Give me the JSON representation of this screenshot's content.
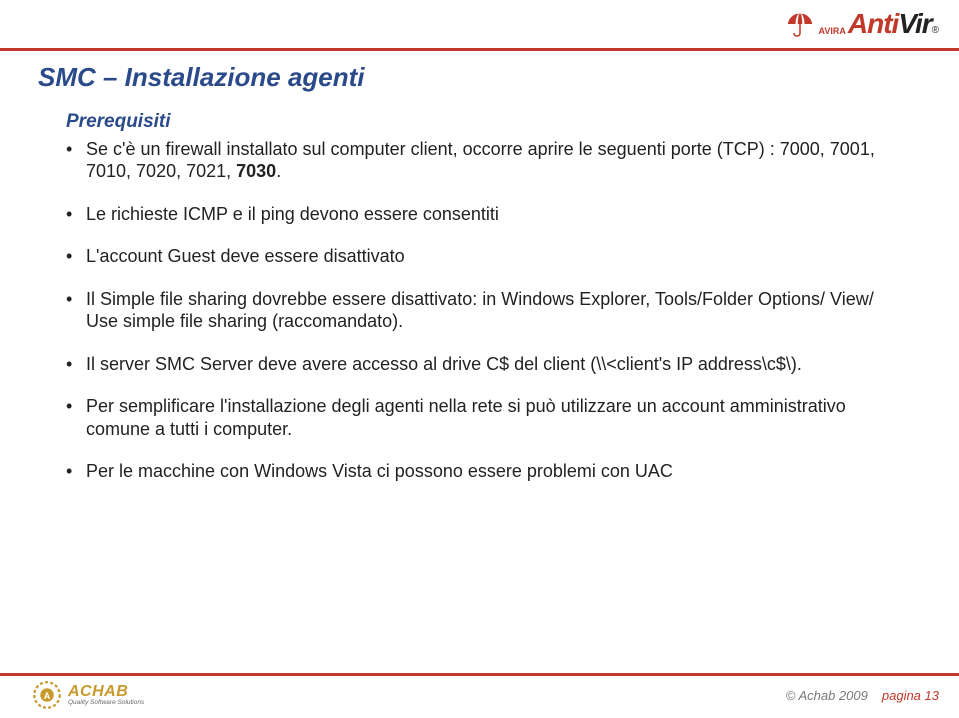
{
  "brand": {
    "avira": "AVIRA",
    "anti": "Anti",
    "vir": "Vir",
    "reg": "®"
  },
  "title": "SMC – Installazione agenti",
  "subhead": "Prerequisiti",
  "bullets": [
    {
      "pre": "Se c'è un firewall installato sul computer client, occorre aprire le seguenti porte (TCP) : 7000, 7001, 7010, 7020, 7021, ",
      "bold": "7030",
      "post": "."
    },
    {
      "pre": "Le richieste ICMP e il ping devono essere consentiti",
      "bold": "",
      "post": ""
    },
    {
      "pre": "L'account Guest deve essere disattivato",
      "bold": "",
      "post": ""
    },
    {
      "pre": "Il Simple file sharing dovrebbe essere disattivato: in Windows Explorer, Tools/Folder Options/ View/ Use simple file sharing (raccomandato).",
      "bold": "",
      "post": ""
    },
    {
      "pre": "Il server SMC Server deve avere accesso al drive C$ del client (\\\\<client's IP address\\c$\\).",
      "bold": "",
      "post": ""
    },
    {
      "pre": "Per semplificare l'installazione degli agenti nella rete si può utilizzare un account amministrativo comune a tutti i computer.",
      "bold": "",
      "post": ""
    },
    {
      "pre": "Per le macchine con Windows Vista ci possono essere problemi con UAC",
      "bold": "",
      "post": ""
    }
  ],
  "footer": {
    "achab_main": "ACHAB",
    "achab_sub": "Quality Software Solutions",
    "copyright": "© Achab 2009",
    "page": "pagina 13"
  }
}
